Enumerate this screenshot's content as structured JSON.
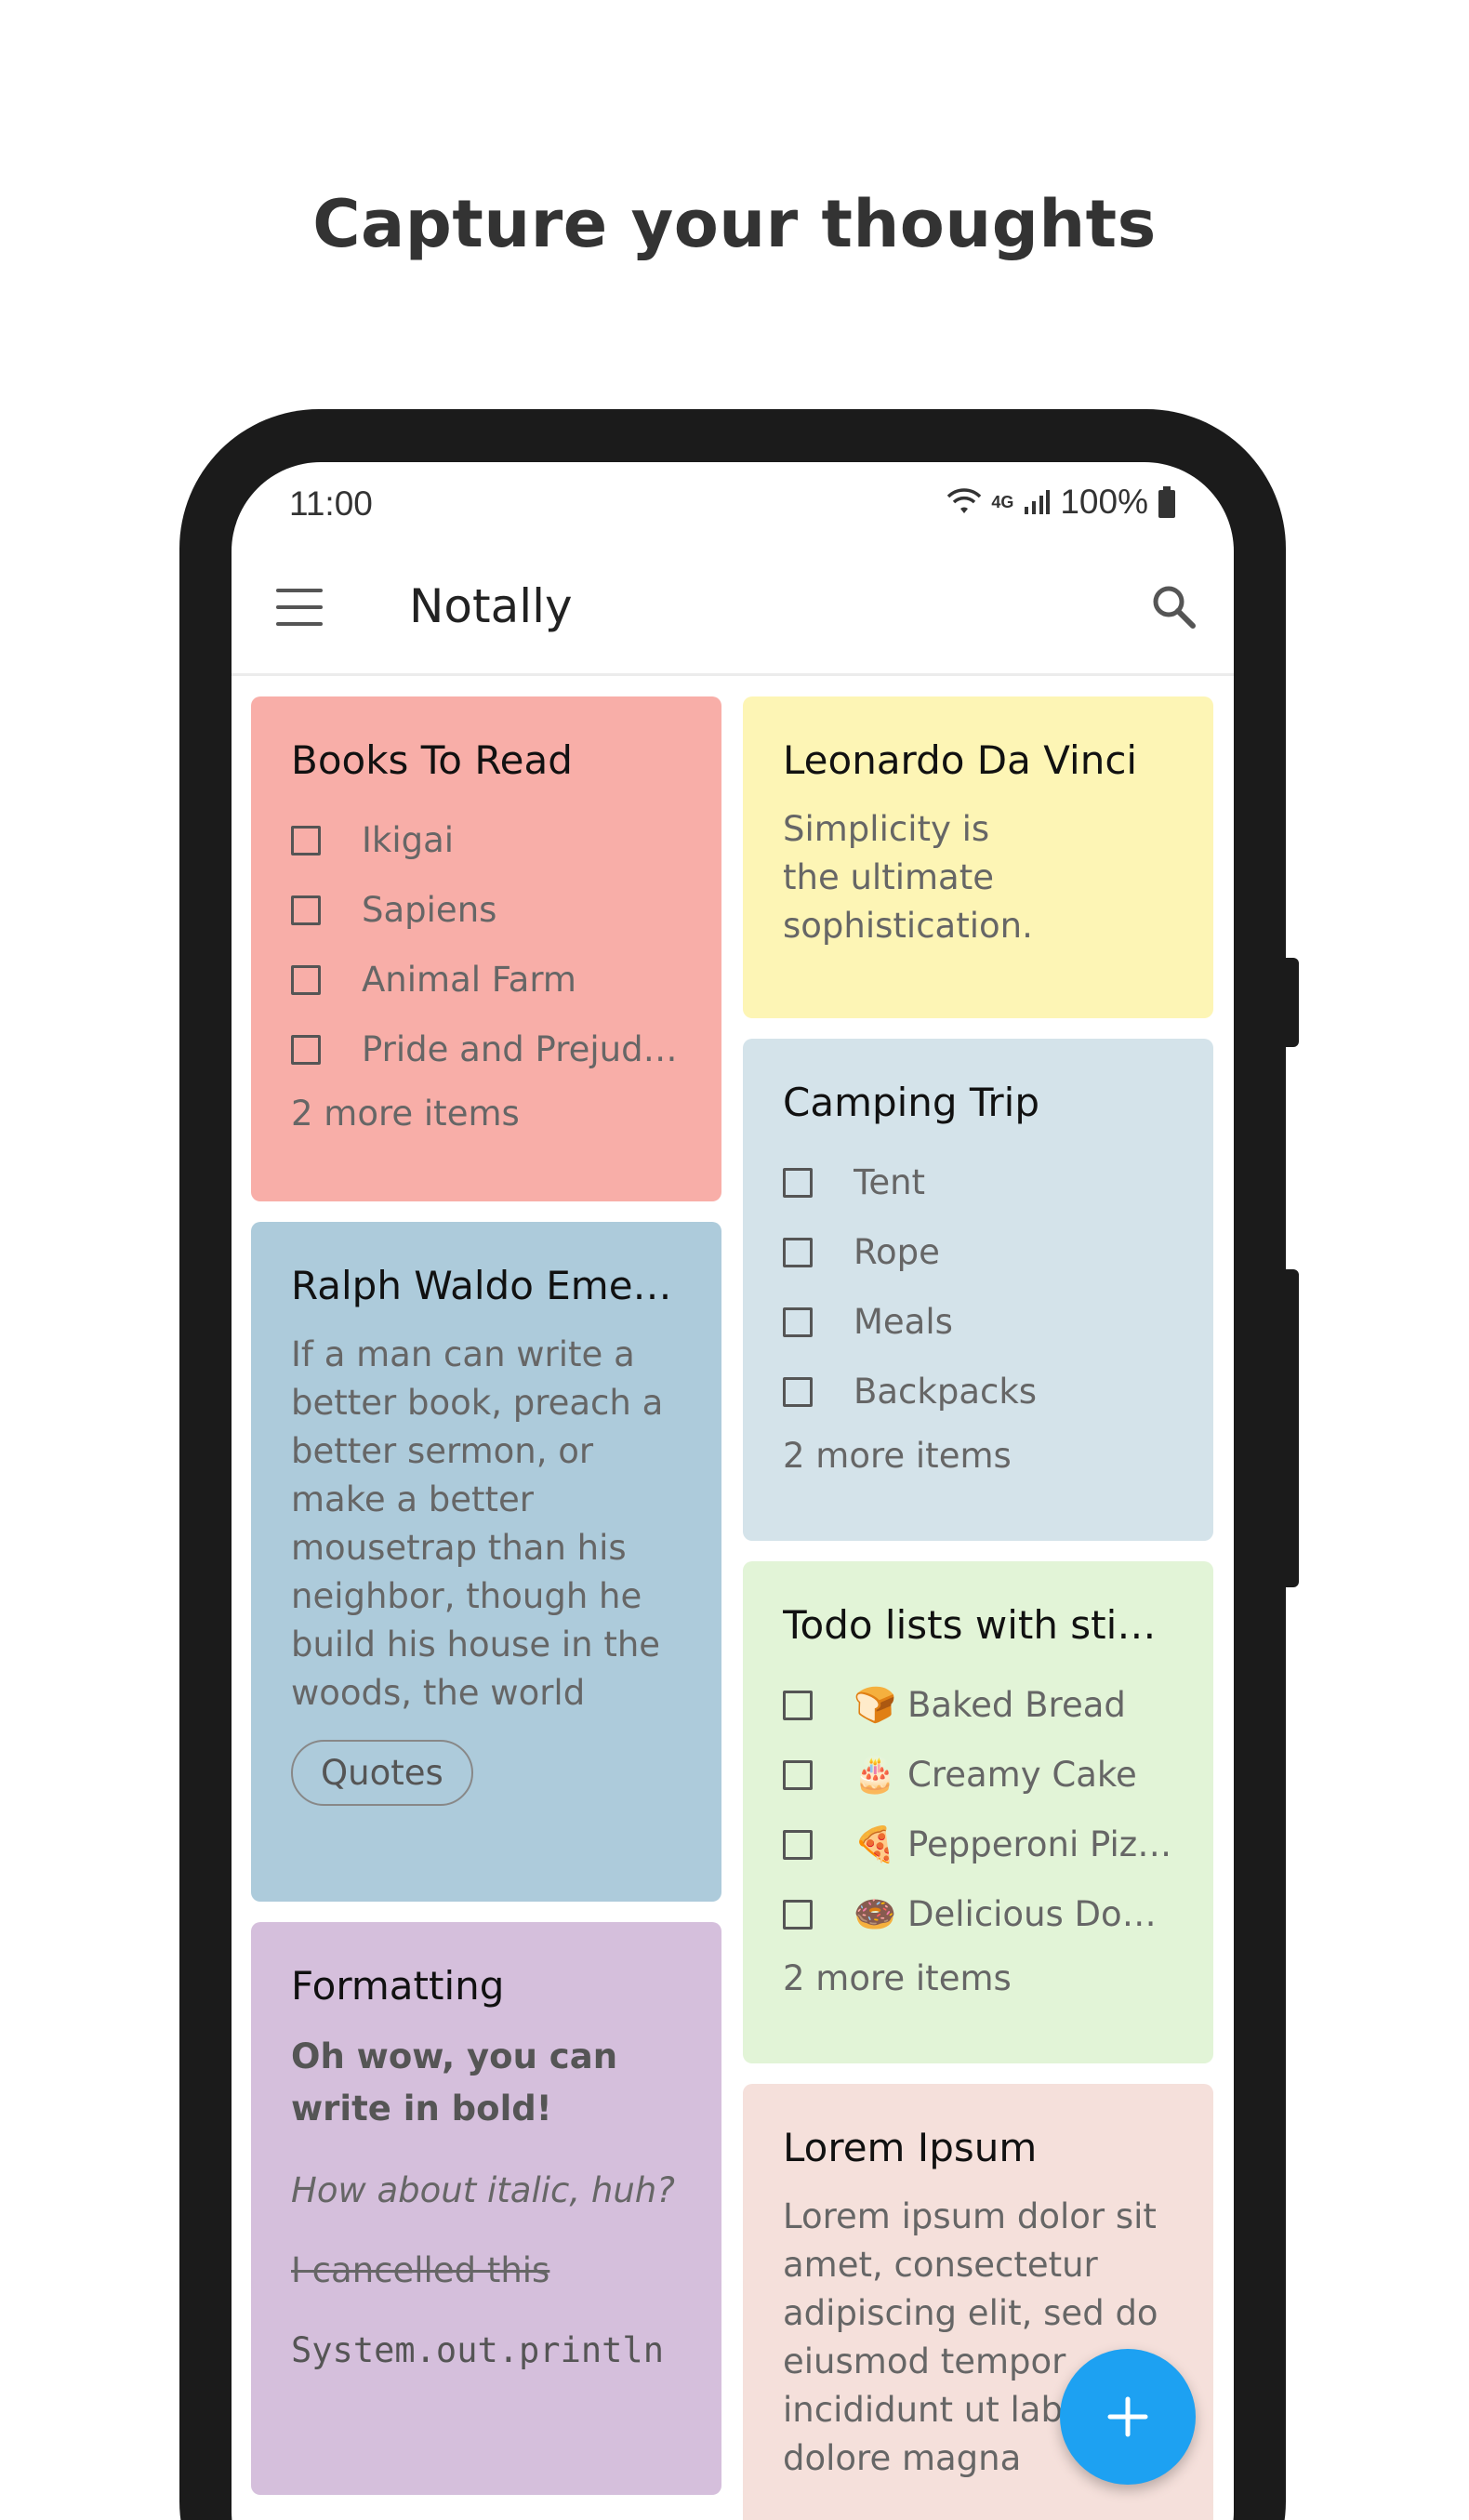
{
  "headline": "Capture your thoughts",
  "status": {
    "time": "11:00",
    "network": "4G",
    "battery": "100%"
  },
  "toolbar": {
    "title": "Notally"
  },
  "notes": {
    "books": {
      "title": "Books To Read",
      "items": [
        "Ikigai",
        "Sapiens",
        "Animal Farm",
        "Pride and Prejudice"
      ],
      "more": "2 more items",
      "color": "#f8aea8"
    },
    "emerson": {
      "title": "Ralph Waldo Emerson",
      "body": "If a man can write a better book, preach a better sermon, or make a better mousetrap than his neighbor, though he build his house in the woods, the world will…",
      "label": "Quotes",
      "color": "#adcbdb"
    },
    "formatting": {
      "title": "Formatting",
      "bold": "Oh wow, you can write in bold!",
      "italic": "How about italic, huh?",
      "strike": "I cancelled this",
      "mono": "System.out.println",
      "color": "#d5bfdc"
    },
    "davinci": {
      "title": "Leonardo Da Vinci",
      "body": "Simplicity is the ultimate sophistication.",
      "color": "#fdf5b5"
    },
    "camping": {
      "title": "Camping Trip",
      "items": [
        "Tent",
        "Rope",
        "Meals",
        "Backpacks"
      ],
      "more": "2 more items",
      "color": "#d4e3ea"
    },
    "todo": {
      "title": "Todo lists with stickers",
      "items": [
        {
          "emoji": "🍞",
          "label": "Baked Bread"
        },
        {
          "emoji": "🎂",
          "label": "Creamy Cake"
        },
        {
          "emoji": "🍕",
          "label": "Pepperoni Pizza"
        },
        {
          "emoji": "🍩",
          "label": "Delicious Donuts"
        }
      ],
      "more": "2 more items",
      "color": "#e2f4d7"
    },
    "lorem": {
      "title": "Lorem Ipsum",
      "body": "Lorem ipsum dolor sit amet, consectetur adipiscing elit, sed do eiusmod tempor incididunt ut labore et dolore magna",
      "color": "#f5e0db"
    }
  },
  "fab": {
    "icon": "plus-icon",
    "color": "#1da1f2"
  }
}
